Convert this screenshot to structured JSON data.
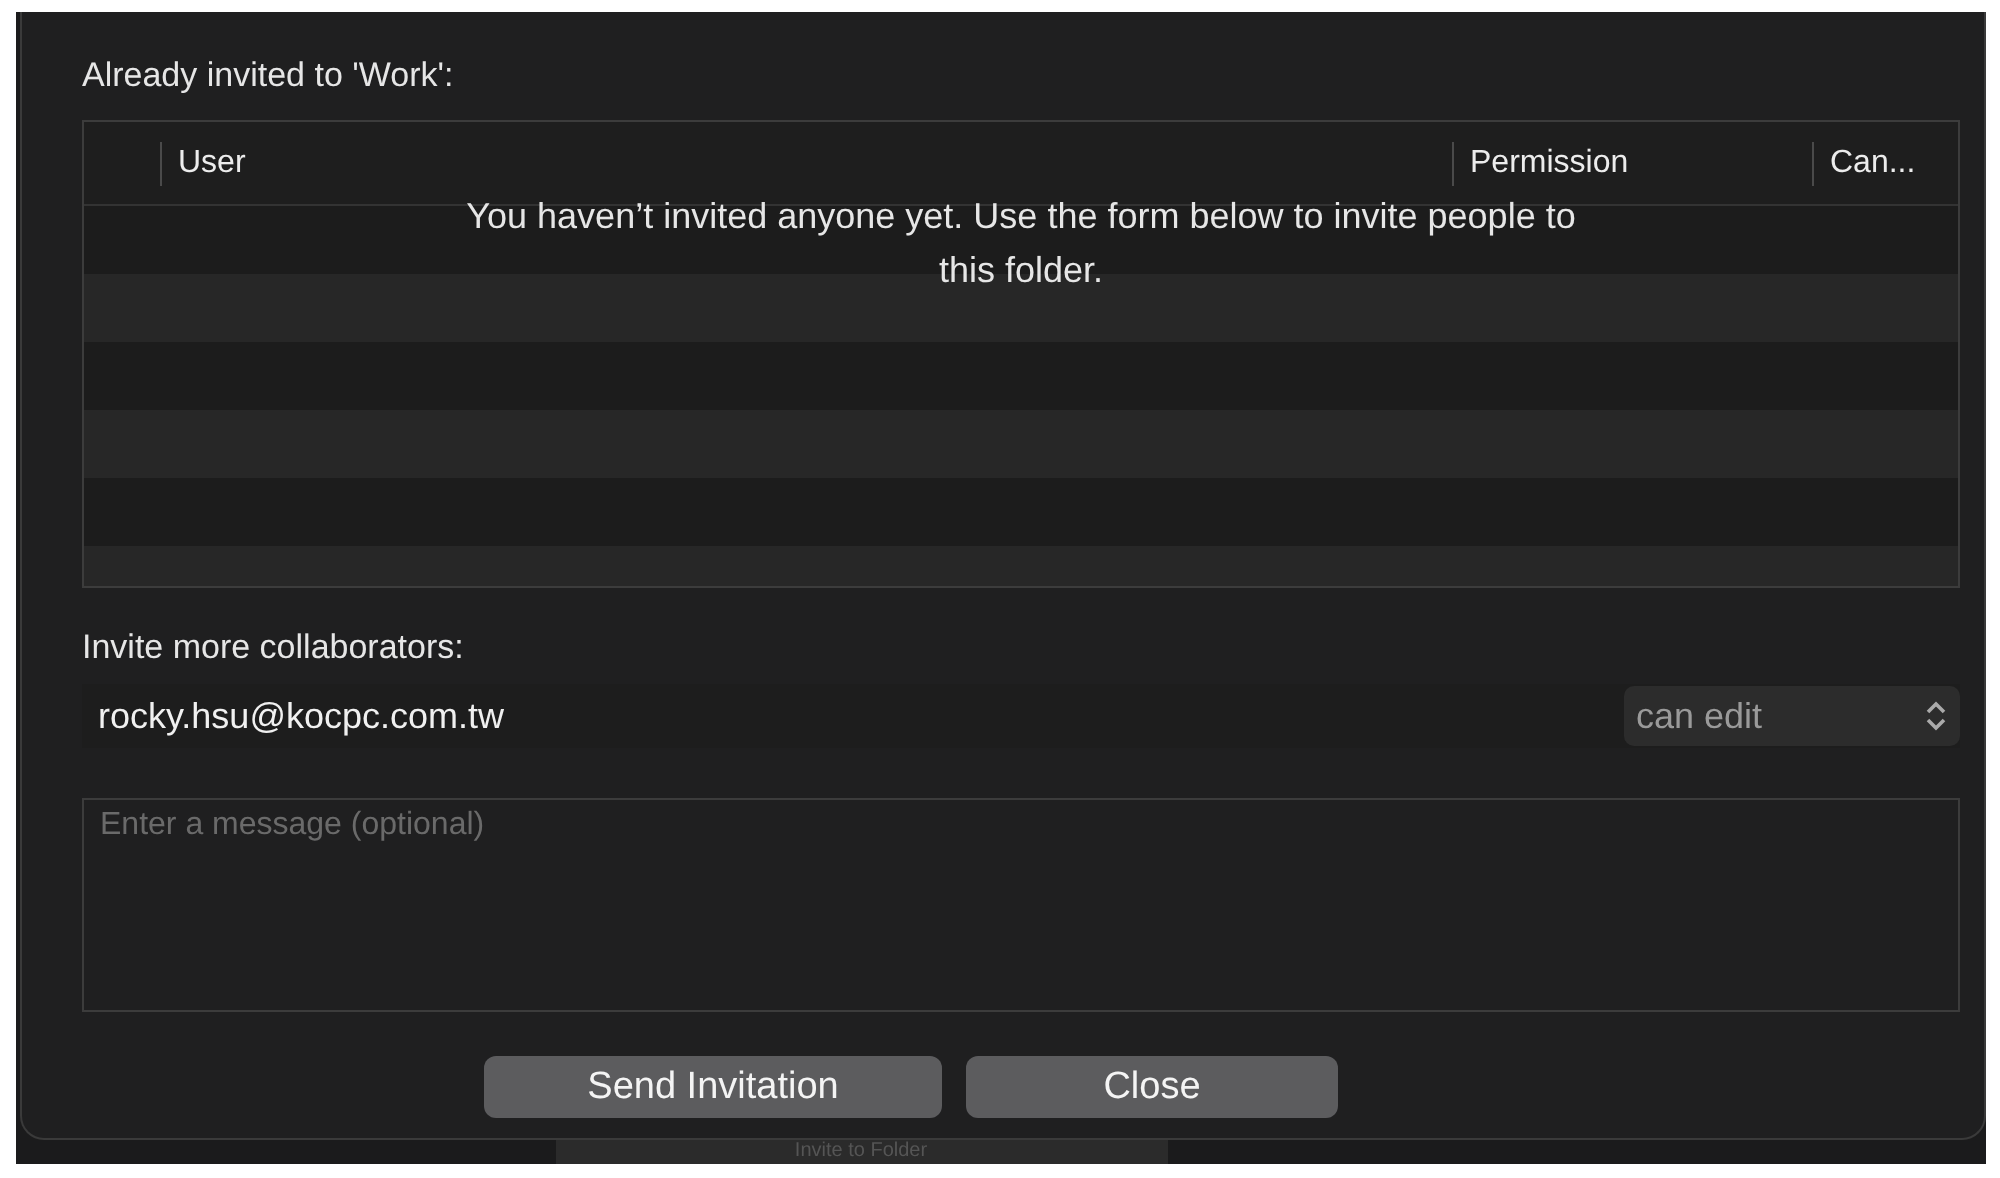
{
  "dialog": {
    "heading": "Already invited to 'Work':",
    "table": {
      "columns": [
        {
          "label": "User"
        },
        {
          "label": "Permission"
        },
        {
          "label": "Can..."
        }
      ],
      "empty_message": "You haven’t invited anyone yet. Use the form below to invite people to this folder."
    },
    "invite_label": "Invite more collaborators:",
    "email": {
      "value": "rocky.hsu@kocpc.com.tw"
    },
    "permission": {
      "value": "can edit"
    },
    "message": {
      "placeholder": "Enter a message (optional)"
    },
    "buttons": [
      {
        "label": "Send Invitation"
      },
      {
        "label": "Close"
      }
    ]
  },
  "background_button": {
    "label": "Invite to Folder"
  }
}
